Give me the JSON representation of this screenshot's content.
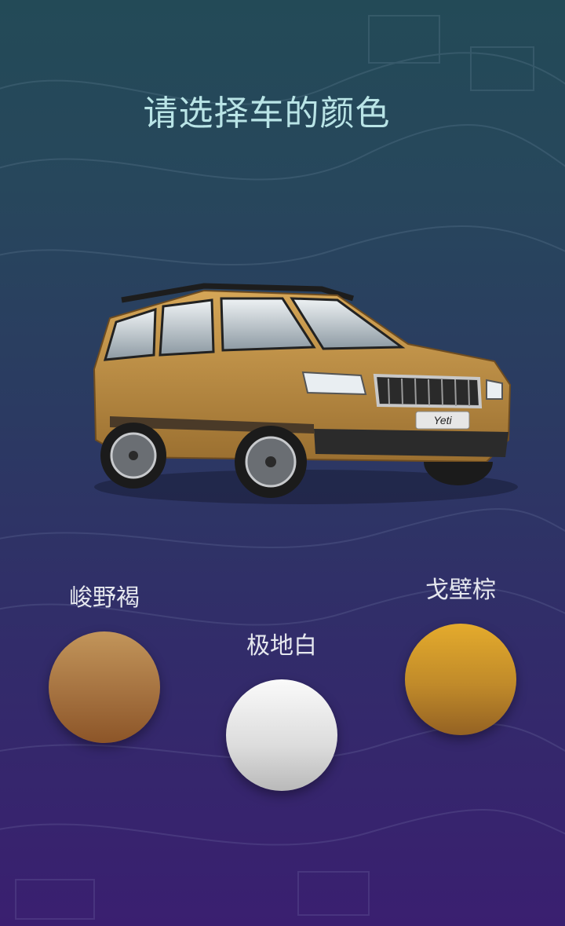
{
  "header": {
    "title": "请选择车的颜色"
  },
  "car": {
    "model_badge": "Yeti",
    "body_color": "#b68a44"
  },
  "colors": [
    {
      "label": "峻野褐",
      "hex": "#a57240"
    },
    {
      "label": "极地白",
      "hex": "#e4e4e4"
    },
    {
      "label": "戈壁棕",
      "hex": "#d19c2b"
    }
  ]
}
